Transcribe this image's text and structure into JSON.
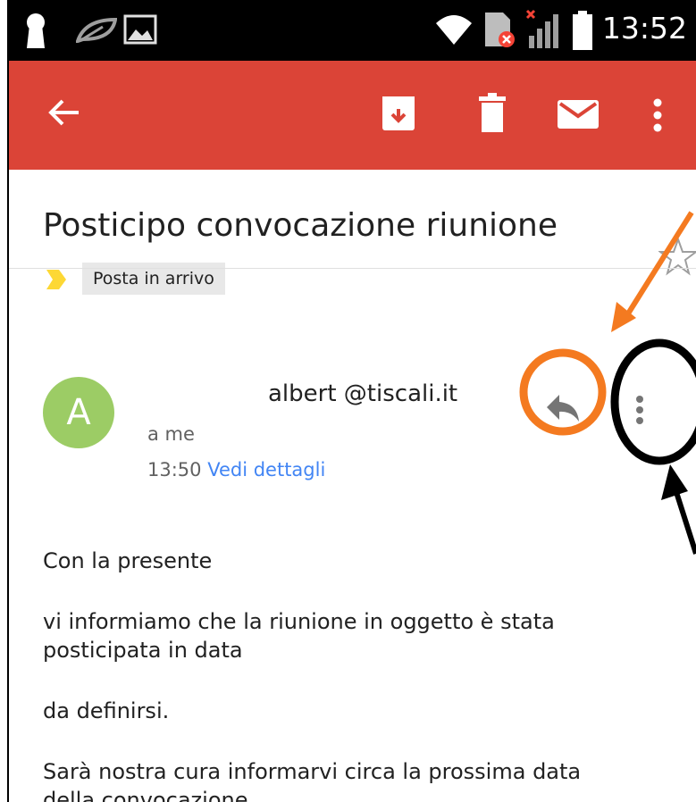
{
  "statusbar": {
    "time": "13:52",
    "icons": [
      "keyhole-icon",
      "leaf-icon",
      "image-icon",
      "wifi-icon",
      "sim-error-icon",
      "signal-icon",
      "battery-icon"
    ]
  },
  "appbar": {
    "icons": [
      "back-arrow-icon",
      "archive-icon",
      "trash-icon",
      "mail-icon",
      "more-vert-icon"
    ],
    "color": "#db4437"
  },
  "message": {
    "subject": "Posticipo convocazione riunione",
    "label": "Posta in arrivo",
    "avatar_letter": "A",
    "avatar_color": "#9ccc65",
    "sender": "albert @tiscali.it",
    "recipient": "a me",
    "time": "13:50",
    "details_link": "Vedi dettagli",
    "body": [
      "Con la presente",
      "vi informiamo che la riunione in oggetto è stata",
      "posticipata in data",
      "da definirsi.",
      "Sarà nostra cura informarvi circa la prossima data",
      "della convocazione."
    ]
  },
  "annotations": {
    "orange": "#f47a20",
    "black": "#000000"
  }
}
